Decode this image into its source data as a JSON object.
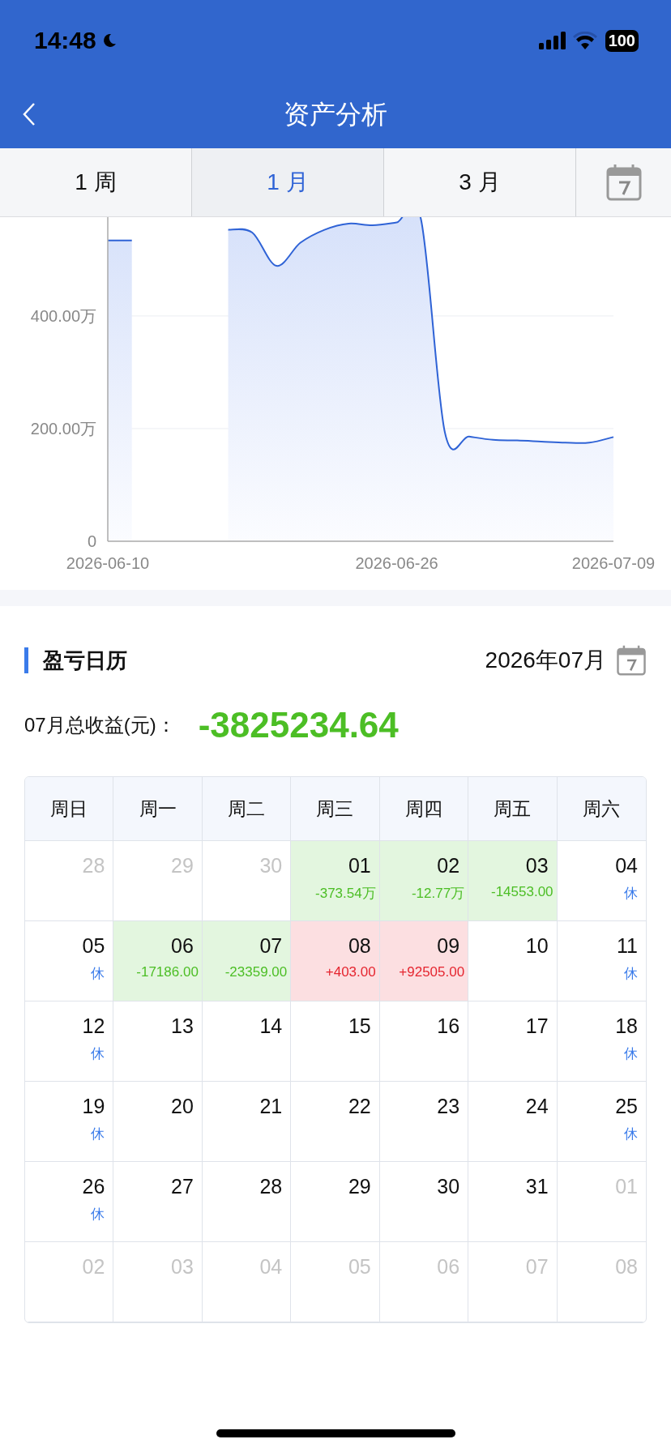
{
  "status_bar": {
    "time": "14:48",
    "battery": "100"
  },
  "nav": {
    "title": "资产分析"
  },
  "tabs": [
    {
      "label": "1 周",
      "selected": false
    },
    {
      "label": "1 月",
      "selected": true
    },
    {
      "label": "3 月",
      "selected": false
    }
  ],
  "chart": {
    "chart_data": {
      "type": "area",
      "categories": [
        "2026-06-10",
        null,
        null,
        null,
        null,
        null,
        null,
        null,
        null,
        null,
        null,
        null,
        "2026-06-26",
        null,
        null,
        null,
        null,
        null,
        null,
        null,
        null,
        "2026-07-09"
      ],
      "series": [
        {
          "color": "#2f63d6",
          "values": [
            534,
            534,
            null,
            null,
            null,
            553,
            548,
            489,
            530,
            553,
            564,
            561,
            566,
            573,
            193,
            186,
            180,
            179,
            177,
            175,
            175,
            185
          ]
        }
      ],
      "ylim": [
        0,
        620
      ],
      "yticks": [
        {
          "value": 0,
          "label": "0"
        },
        {
          "value": 200,
          "label": "200.00万"
        },
        {
          "value": 400,
          "label": "400.00万"
        }
      ]
    }
  },
  "calendar": {
    "title": "盈亏日历",
    "month": "2026年07月",
    "total_label": "07月总收益(元)：",
    "total_value": "-3825234.64",
    "weekdays": [
      "周日",
      "周一",
      "周二",
      "周三",
      "周四",
      "周五",
      "周六"
    ],
    "weeks": [
      [
        {
          "day": "28",
          "muted": true
        },
        {
          "day": "29",
          "muted": true
        },
        {
          "day": "30",
          "muted": true
        },
        {
          "day": "01",
          "muted": false,
          "kind": "loss",
          "note": "-373.54万"
        },
        {
          "day": "02",
          "muted": false,
          "kind": "loss",
          "note": "-12.77万"
        },
        {
          "day": "03",
          "muted": false,
          "kind": "loss",
          "note": "-14553.00"
        },
        {
          "day": "04",
          "muted": false,
          "kind": "rest",
          "note": "休"
        }
      ],
      [
        {
          "day": "05",
          "muted": false,
          "kind": "rest",
          "note": "休"
        },
        {
          "day": "06",
          "muted": false,
          "kind": "loss",
          "note": "-17186.00"
        },
        {
          "day": "07",
          "muted": false,
          "kind": "loss",
          "note": "-23359.00"
        },
        {
          "day": "08",
          "muted": false,
          "kind": "gain",
          "note": "+403.00"
        },
        {
          "day": "09",
          "muted": false,
          "kind": "gain",
          "note": "+92505.00"
        },
        {
          "day": "10",
          "muted": false
        },
        {
          "day": "11",
          "muted": false,
          "kind": "rest",
          "note": "休"
        }
      ],
      [
        {
          "day": "12",
          "muted": false,
          "kind": "rest",
          "note": "休"
        },
        {
          "day": "13",
          "muted": false
        },
        {
          "day": "14",
          "muted": false
        },
        {
          "day": "15",
          "muted": false
        },
        {
          "day": "16",
          "muted": false
        },
        {
          "day": "17",
          "muted": false
        },
        {
          "day": "18",
          "muted": false,
          "kind": "rest",
          "note": "休"
        }
      ],
      [
        {
          "day": "19",
          "muted": false,
          "kind": "rest",
          "note": "休"
        },
        {
          "day": "20",
          "muted": false
        },
        {
          "day": "21",
          "muted": false
        },
        {
          "day": "22",
          "muted": false
        },
        {
          "day": "23",
          "muted": false
        },
        {
          "day": "24",
          "muted": false
        },
        {
          "day": "25",
          "muted": false,
          "kind": "rest",
          "note": "休"
        }
      ],
      [
        {
          "day": "26",
          "muted": false,
          "kind": "rest",
          "note": "休"
        },
        {
          "day": "27",
          "muted": false
        },
        {
          "day": "28",
          "muted": false
        },
        {
          "day": "29",
          "muted": false
        },
        {
          "day": "30",
          "muted": false
        },
        {
          "day": "31",
          "muted": false
        },
        {
          "day": "01",
          "muted": true
        }
      ],
      [
        {
          "day": "02",
          "muted": true
        },
        {
          "day": "03",
          "muted": true
        },
        {
          "day": "04",
          "muted": true
        },
        {
          "day": "05",
          "muted": true
        },
        {
          "day": "06",
          "muted": true
        },
        {
          "day": "07",
          "muted": true
        },
        {
          "day": "08",
          "muted": true
        }
      ]
    ]
  }
}
